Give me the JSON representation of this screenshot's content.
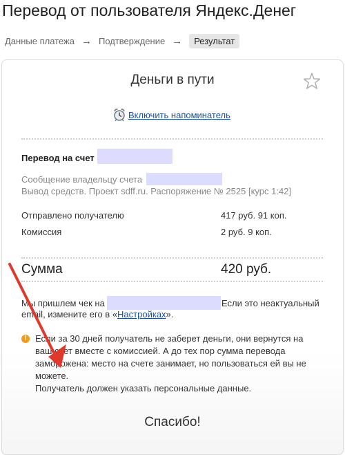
{
  "page_title": "Перевод от пользователя Яндекс.Денег",
  "breadcrumbs": [
    {
      "label": "Данные платежа"
    },
    {
      "label": "Подтверждение"
    },
    {
      "label": "Результат"
    }
  ],
  "breadcrumb_separator": "→",
  "card": {
    "title": "Деньги в пути",
    "reminder_link": "Включить напоминатель",
    "transfer_label": "Перевод на счет",
    "message_label": "Сообщение владельцу счета",
    "withdraw_text": "Вывод средств. Проект sdff.ru. Распоряжение № 2525 [курс 1:42]",
    "sent_label": "Отправлено получателю",
    "sent_value": "417 руб. 91 коп.",
    "commission_label": "Комиссия",
    "commission_value": "2 руб. 9 коп.",
    "sum_label": "Сумма",
    "sum_value": "420 руб.",
    "receipt_text_1": "Мы пришлем чек на",
    "receipt_text_2": "Если это неактуальный",
    "receipt_text_3": "email, измените его в «",
    "settings_link": "Настройках",
    "receipt_text_4": "».",
    "warning_icon": "!",
    "warning_line1": "Если за 30 дней получатель не заберет деньги, они вернутся на",
    "warning_line2": "ваш счет вместе с комиссией. А до тех пор сумма перевода",
    "warning_line3": "заморожена: место на счете занимает, но пользоваться ей вы не",
    "warning_line4": "можете.",
    "warning_line5": "Получатель должен указать персональные данные.",
    "thanks": "Спасибо!"
  },
  "colors": {
    "link": "#1f4fa0",
    "redaction": "#dcdcff",
    "warning": "#f39a1e",
    "annotation_arrow": "#e0392b"
  }
}
